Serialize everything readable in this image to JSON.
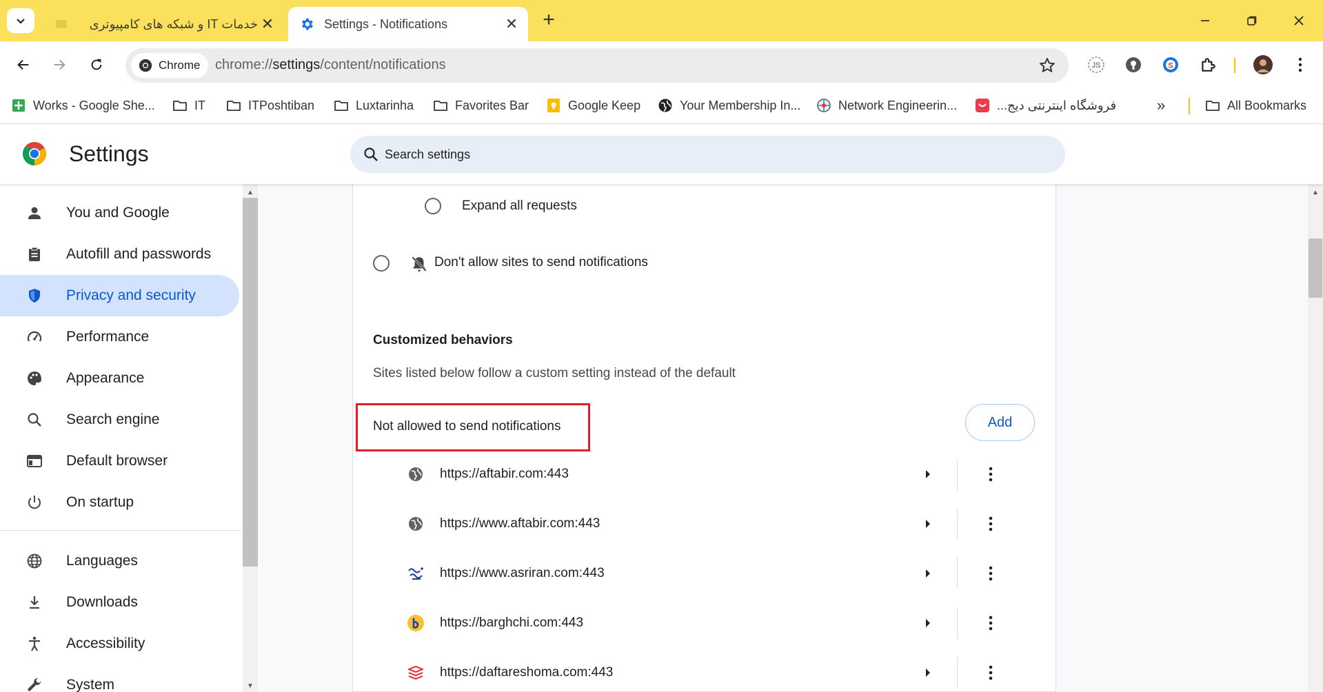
{
  "browser": {
    "tabs": [
      {
        "title": "خدمات IT و شبکه های کامپیوتری",
        "active": false,
        "favicon": "site-favicon-icon"
      },
      {
        "title": "Settings - Notifications",
        "active": true,
        "favicon": "gear-icon"
      }
    ],
    "omnibox": {
      "chip_label": "Chrome",
      "url_scheme": "chrome://",
      "url_host": "settings",
      "url_path": "/content/notifications"
    },
    "bookmarks": [
      {
        "label": "Works - Google She...",
        "icon": "google-sheets-icon"
      },
      {
        "label": "IT",
        "icon": "folder-icon"
      },
      {
        "label": "ITPoshtiban",
        "icon": "folder-icon"
      },
      {
        "label": "Luxtarinha",
        "icon": "folder-icon"
      },
      {
        "label": "Favorites Bar",
        "icon": "folder-icon"
      },
      {
        "label": "Google Keep",
        "icon": "google-keep-icon"
      },
      {
        "label": "Your Membership In...",
        "icon": "globe-icon"
      },
      {
        "label": "Network Engineerin...",
        "icon": "network-icon"
      },
      {
        "label": "فروشگاه اینترنتی دیج...",
        "icon": "digikala-icon"
      }
    ],
    "all_bookmarks": "All Bookmarks",
    "accent_color": "#fbe05b"
  },
  "settings": {
    "title": "Settings",
    "search_placeholder": "Search settings",
    "nav": [
      {
        "label": "You and Google",
        "icon": "person-icon"
      },
      {
        "label": "Autofill and passwords",
        "icon": "clipboard-icon"
      },
      {
        "label": "Privacy and security",
        "icon": "shield-icon",
        "selected": true
      },
      {
        "label": "Performance",
        "icon": "speedometer-icon"
      },
      {
        "label": "Appearance",
        "icon": "palette-icon"
      },
      {
        "label": "Search engine",
        "icon": "search-icon"
      },
      {
        "label": "Default browser",
        "icon": "browser-window-icon"
      },
      {
        "label": "On startup",
        "icon": "power-icon"
      },
      {
        "label": "Languages",
        "icon": "globe-icon"
      },
      {
        "label": "Downloads",
        "icon": "download-icon"
      },
      {
        "label": "Accessibility",
        "icon": "accessibility-icon"
      },
      {
        "label": "System",
        "icon": "wrench-icon"
      }
    ]
  },
  "notifications": {
    "expand_all": "Expand all requests",
    "dont_allow": "Don't allow sites to send notifications",
    "customized_title": "Customized behaviors",
    "customized_sub": "Sites listed below follow a custom setting instead of the default",
    "not_allowed_label": "Not allowed to send notifications",
    "add_label": "Add",
    "sites": [
      {
        "url": "https://aftabir.com:443",
        "icon": "globe-icon"
      },
      {
        "url": "https://www.aftabir.com:443",
        "icon": "globe-icon"
      },
      {
        "url": "https://www.asriran.com:443",
        "icon": "asriran-logo-icon"
      },
      {
        "url": "https://barghchi.com:443",
        "icon": "barghchi-logo-icon"
      },
      {
        "url": "https://daftareshoma.com:443",
        "icon": "daftareshoma-logo-icon"
      }
    ],
    "highlight_color": "#e11d2a"
  }
}
